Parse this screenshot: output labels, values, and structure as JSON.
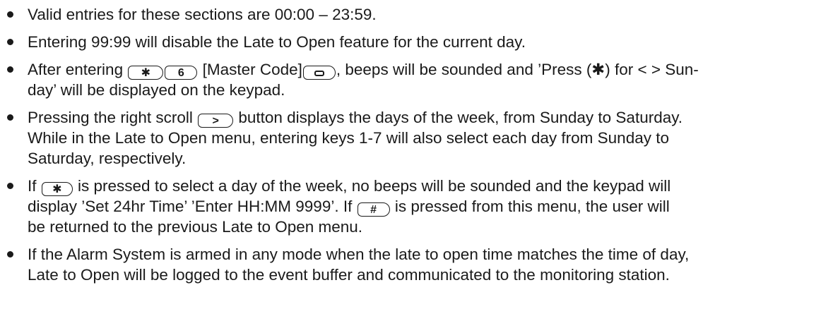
{
  "bullets": [
    {
      "lines": [
        "Valid entries for these sections are 00:00 – 23:59."
      ]
    },
    {
      "lines": [
        "Entering 99:99 will disable the Late to Open feature for the current day."
      ]
    },
    {
      "line1_pre": "After entering ",
      "key_star": "✱",
      "key_6": "6",
      "line1_mid": " [Master Code]",
      "line1_post": ", beeps will be sounded and ’Press (",
      "star_glyph": "✱",
      "line1_end": ") for < > Sun-",
      "line2": "day’ will be displayed on the keypad."
    },
    {
      "line1_pre": "Pressing the right scroll ",
      "key_right": ">",
      "line1_post": " button displays the days of the week, from Sunday to Saturday.",
      "line2": "While in the Late to Open menu, entering keys 1-7 will also select each day from Sunday to",
      "line3": "Saturday, respectively."
    },
    {
      "line1_pre": "If ",
      "key_star": "✱",
      "line1_post": " is pressed to select a day of the week, no beeps will be sounded and the keypad will",
      "line2_pre": "display ’Set 24hr Time’ ’Enter HH:MM 9999’.  If ",
      "key_hash": "#",
      "line2_post": " is pressed from this menu, the user will",
      "line3": "be returned to the previous Late to Open menu."
    },
    {
      "line1": "If the Alarm System is armed in any mode when the late to open time matches the time of day,",
      "line2": "Late to Open will be logged to the event buffer and communicated to the monitoring station."
    }
  ],
  "icons": {
    "bullet": "bullet-dot",
    "key_enter": "rectangle-key"
  }
}
